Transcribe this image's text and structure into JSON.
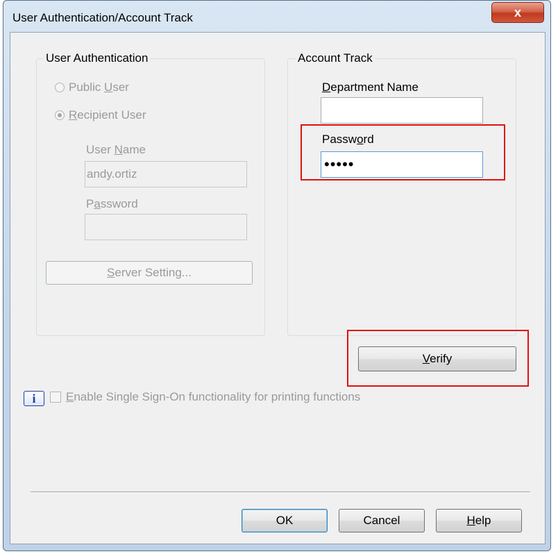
{
  "window": {
    "title": "User Authentication/Account Track",
    "close_label": "x"
  },
  "user_auth": {
    "title": "User Authentication",
    "public_user_pre": "Public ",
    "public_user_u": "U",
    "public_user_post": "ser",
    "recipient_user_u": "R",
    "recipient_user_post": "ecipient User",
    "user_name_pre": "User ",
    "user_name_u": "N",
    "user_name_post": "ame",
    "user_name_value": "andy.ortiz",
    "password_pre": "P",
    "password_u": "a",
    "password_post": "ssword",
    "password_value": "",
    "server_setting_u": "S",
    "server_setting_post": "erver Setting..."
  },
  "account_track": {
    "title": "Account Track",
    "dept_u": "D",
    "dept_post": "epartment Name",
    "dept_value": "",
    "password_pre": "Passw",
    "password_u": "o",
    "password_post": "rd",
    "password_value": "•••••",
    "verify_u": "V",
    "verify_post": "erify"
  },
  "sso": {
    "label_u": "E",
    "label_post": "nable Single Sign-On functionality for printing functions",
    "info_icon": "i"
  },
  "footer": {
    "ok": "OK",
    "cancel": "Cancel",
    "help_u": "H",
    "help_post": "elp"
  }
}
